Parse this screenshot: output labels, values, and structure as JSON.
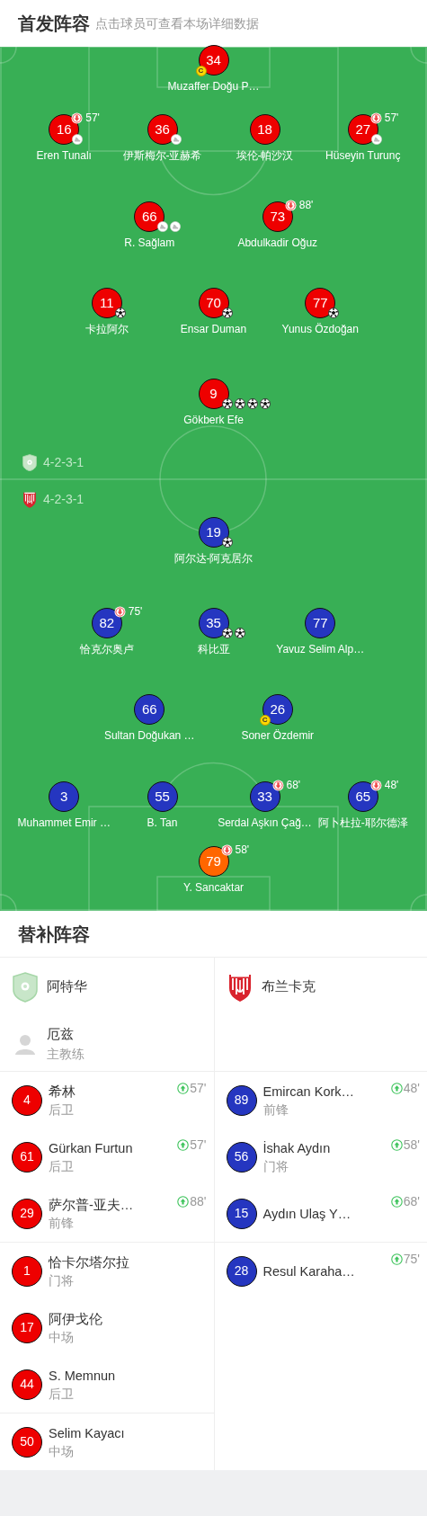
{
  "header": {
    "title": "首发阵容",
    "subtitle": "点击球员可查看本场详细数据"
  },
  "home": {
    "formation": "4-2-3-1",
    "lines": [
      [
        {
          "number": "34",
          "name": "Muzaffer Doğu P…",
          "color": "#ee0000",
          "captain_badge": "C"
        }
      ],
      [
        {
          "number": "16",
          "name": "Eren Tunalı",
          "color": "#ee0000",
          "sub_out": "57'",
          "events": [
            {
              "kind": "assist"
            }
          ]
        },
        {
          "number": "36",
          "name": "伊斯梅尔-亚赫希",
          "color": "#ee0000",
          "events": [
            {
              "kind": "assist"
            }
          ]
        },
        {
          "number": "18",
          "name": "埃伦-帕沙汉",
          "color": "#ee0000"
        },
        {
          "number": "27",
          "name": "Hüseyin Turunç",
          "color": "#ee0000",
          "sub_out": "57'",
          "events": [
            {
              "kind": "assist"
            }
          ]
        }
      ],
      [
        {
          "number": "66",
          "name": "R. Sağlam",
          "color": "#ee0000",
          "events": [
            {
              "kind": "assist"
            },
            {
              "kind": "assist"
            }
          ]
        },
        {
          "number": "73",
          "name": "Abdulkadir Oğuz",
          "color": "#ee0000",
          "sub_out": "88'"
        }
      ],
      [
        {
          "number": "11",
          "name": "卡拉阿尔",
          "color": "#ee0000",
          "events": [
            {
              "kind": "goal"
            }
          ]
        },
        {
          "number": "70",
          "name": "Ensar Duman",
          "color": "#ee0000",
          "events": [
            {
              "kind": "goal"
            }
          ]
        },
        {
          "number": "77",
          "name": "Yunus Özdoğan",
          "color": "#ee0000",
          "events": [
            {
              "kind": "goal"
            }
          ]
        }
      ],
      [
        {
          "number": "9",
          "name": "Gökberk Efe",
          "color": "#ee0000",
          "events": [
            {
              "kind": "goal"
            },
            {
              "kind": "goal"
            },
            {
              "kind": "goal"
            },
            {
              "kind": "goal"
            }
          ]
        }
      ]
    ]
  },
  "away": {
    "formation": "4-2-3-1",
    "lines": [
      [
        {
          "number": "19",
          "name": "阿尔达-阿克居尔",
          "color": "#2536c0",
          "events": [
            {
              "kind": "goal"
            }
          ]
        }
      ],
      [
        {
          "number": "82",
          "name": "恰克尔奥卢",
          "color": "#2536c0",
          "sub_out": "75'"
        },
        {
          "number": "35",
          "name": "科比亚",
          "color": "#2536c0",
          "events": [
            {
              "kind": "goal"
            },
            {
              "kind": "goal"
            }
          ]
        },
        {
          "number": "77",
          "name": "Yavuz Selim Alp…",
          "color": "#2536c0"
        }
      ],
      [
        {
          "number": "66",
          "name": "Sultan Doğukan …",
          "color": "#2536c0"
        },
        {
          "number": "26",
          "name": "Soner Özdemir",
          "color": "#2536c0",
          "captain_badge": "C"
        }
      ],
      [
        {
          "number": "3",
          "name": "Muhammet Emir …",
          "color": "#2536c0"
        },
        {
          "number": "55",
          "name": "B. Tan",
          "color": "#2536c0"
        },
        {
          "number": "33",
          "name": "Serdal Aşkın Çağ…",
          "color": "#2536c0",
          "sub_out": "68'"
        },
        {
          "number": "65",
          "name": "阿卜杜拉-耶尔德泽",
          "color": "#2536c0",
          "sub_out": "48'"
        }
      ],
      [
        {
          "number": "79",
          "name": "Y. Sancaktar",
          "color": "#ff6600",
          "sub_out": "58'"
        }
      ]
    ]
  },
  "subs": {
    "title": "替补阵容",
    "teams": [
      {
        "name": "阿特华",
        "coach": {
          "name": "厄兹",
          "role": "主教练"
        },
        "players": [
          {
            "number": "4",
            "name": "希林",
            "position": "后卫",
            "sub_in": "57'",
            "color": "#ee0000"
          },
          {
            "number": "61",
            "name": "Gürkan Furtun",
            "position": "后卫",
            "sub_in": "57'",
            "color": "#ee0000"
          },
          {
            "number": "29",
            "name": "萨尔普-亚夫…",
            "position": "前锋",
            "sub_in": "88'",
            "color": "#ee0000"
          },
          {
            "number": "1",
            "name": "恰卡尔塔尔拉",
            "position": "门将",
            "color": "#ee0000"
          },
          {
            "number": "17",
            "name": "阿伊戈伦",
            "position": "中场",
            "color": "#ee0000"
          },
          {
            "number": "44",
            "name": "S. Memnun",
            "position": "后卫",
            "color": "#ee0000"
          },
          {
            "number": "50",
            "name": "Selim Kayacı",
            "position": "中场",
            "color": "#ee0000"
          }
        ]
      },
      {
        "name": "布兰卡克",
        "players": [
          {
            "number": "89",
            "name": "Emircan Kork…",
            "position": "前锋",
            "sub_in": "48'",
            "color": "#2536c0"
          },
          {
            "number": "56",
            "name": "İshak Aydın",
            "position": "门将",
            "sub_in": "58'",
            "color": "#2536c0"
          },
          {
            "number": "15",
            "name": "Aydın Ulaş Y…",
            "sub_in": "68'",
            "color": "#2536c0"
          },
          {
            "number": "28",
            "name": "Resul Karaha…",
            "sub_in": "75'",
            "color": "#2536c0"
          }
        ]
      }
    ]
  }
}
